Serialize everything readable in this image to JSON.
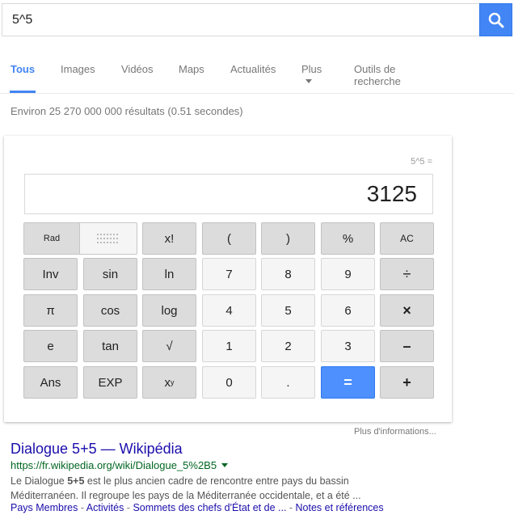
{
  "search": {
    "query": "5^5"
  },
  "tabs": [
    {
      "label": "Tous"
    },
    {
      "label": "Images"
    },
    {
      "label": "Vidéos"
    },
    {
      "label": "Maps"
    },
    {
      "label": "Actualités"
    },
    {
      "label": "Plus"
    },
    {
      "label": "Outils de recherche"
    }
  ],
  "result_stats": "Environ 25 270 000 000 résultats (0.51 secondes)",
  "calculator": {
    "expression": "5^5 =",
    "display": "3125",
    "rad_label": "Rad",
    "keys": {
      "fact": "x!",
      "lparen": "(",
      "rparen": ")",
      "percent": "%",
      "ac": "AC",
      "inv": "Inv",
      "sin": "sin",
      "ln": "ln",
      "k7": "7",
      "k8": "8",
      "k9": "9",
      "divide": "÷",
      "pi": "π",
      "cos": "cos",
      "log": "log",
      "k4": "4",
      "k5": "5",
      "k6": "6",
      "multiply": "×",
      "e": "e",
      "tan": "tan",
      "sqrt": "√",
      "k1": "1",
      "k2": "2",
      "k3": "3",
      "minus": "–",
      "ans": "Ans",
      "exp": "EXP",
      "k0": "0",
      "dot": ".",
      "equals": "=",
      "plus": "+"
    },
    "power_base": "x",
    "power_exp": "y",
    "more_info": "Plus d'informations..."
  },
  "result": {
    "title": "Dialogue 5+5 — Wikipédia",
    "url": "https://fr.wikipedia.org/wiki/Dialogue_5%2B5",
    "snippet_pre": "Le Dialogue ",
    "snippet_bold": "5+5",
    "snippet_post": " est le plus ancien cadre de rencontre entre pays du bassin Méditerranéen. Il regroupe les pays de la Méditerranée occidentale, et a été ...",
    "links": [
      "Pays Membres",
      "Activités",
      "Sommets des chefs d'État et de ...",
      "Notes et références"
    ],
    "link_sep": " - "
  },
  "colors": {
    "accent": "#4285f4",
    "equals_key": "#4d90fe",
    "link": "#1a0dab",
    "url": "#006621"
  }
}
